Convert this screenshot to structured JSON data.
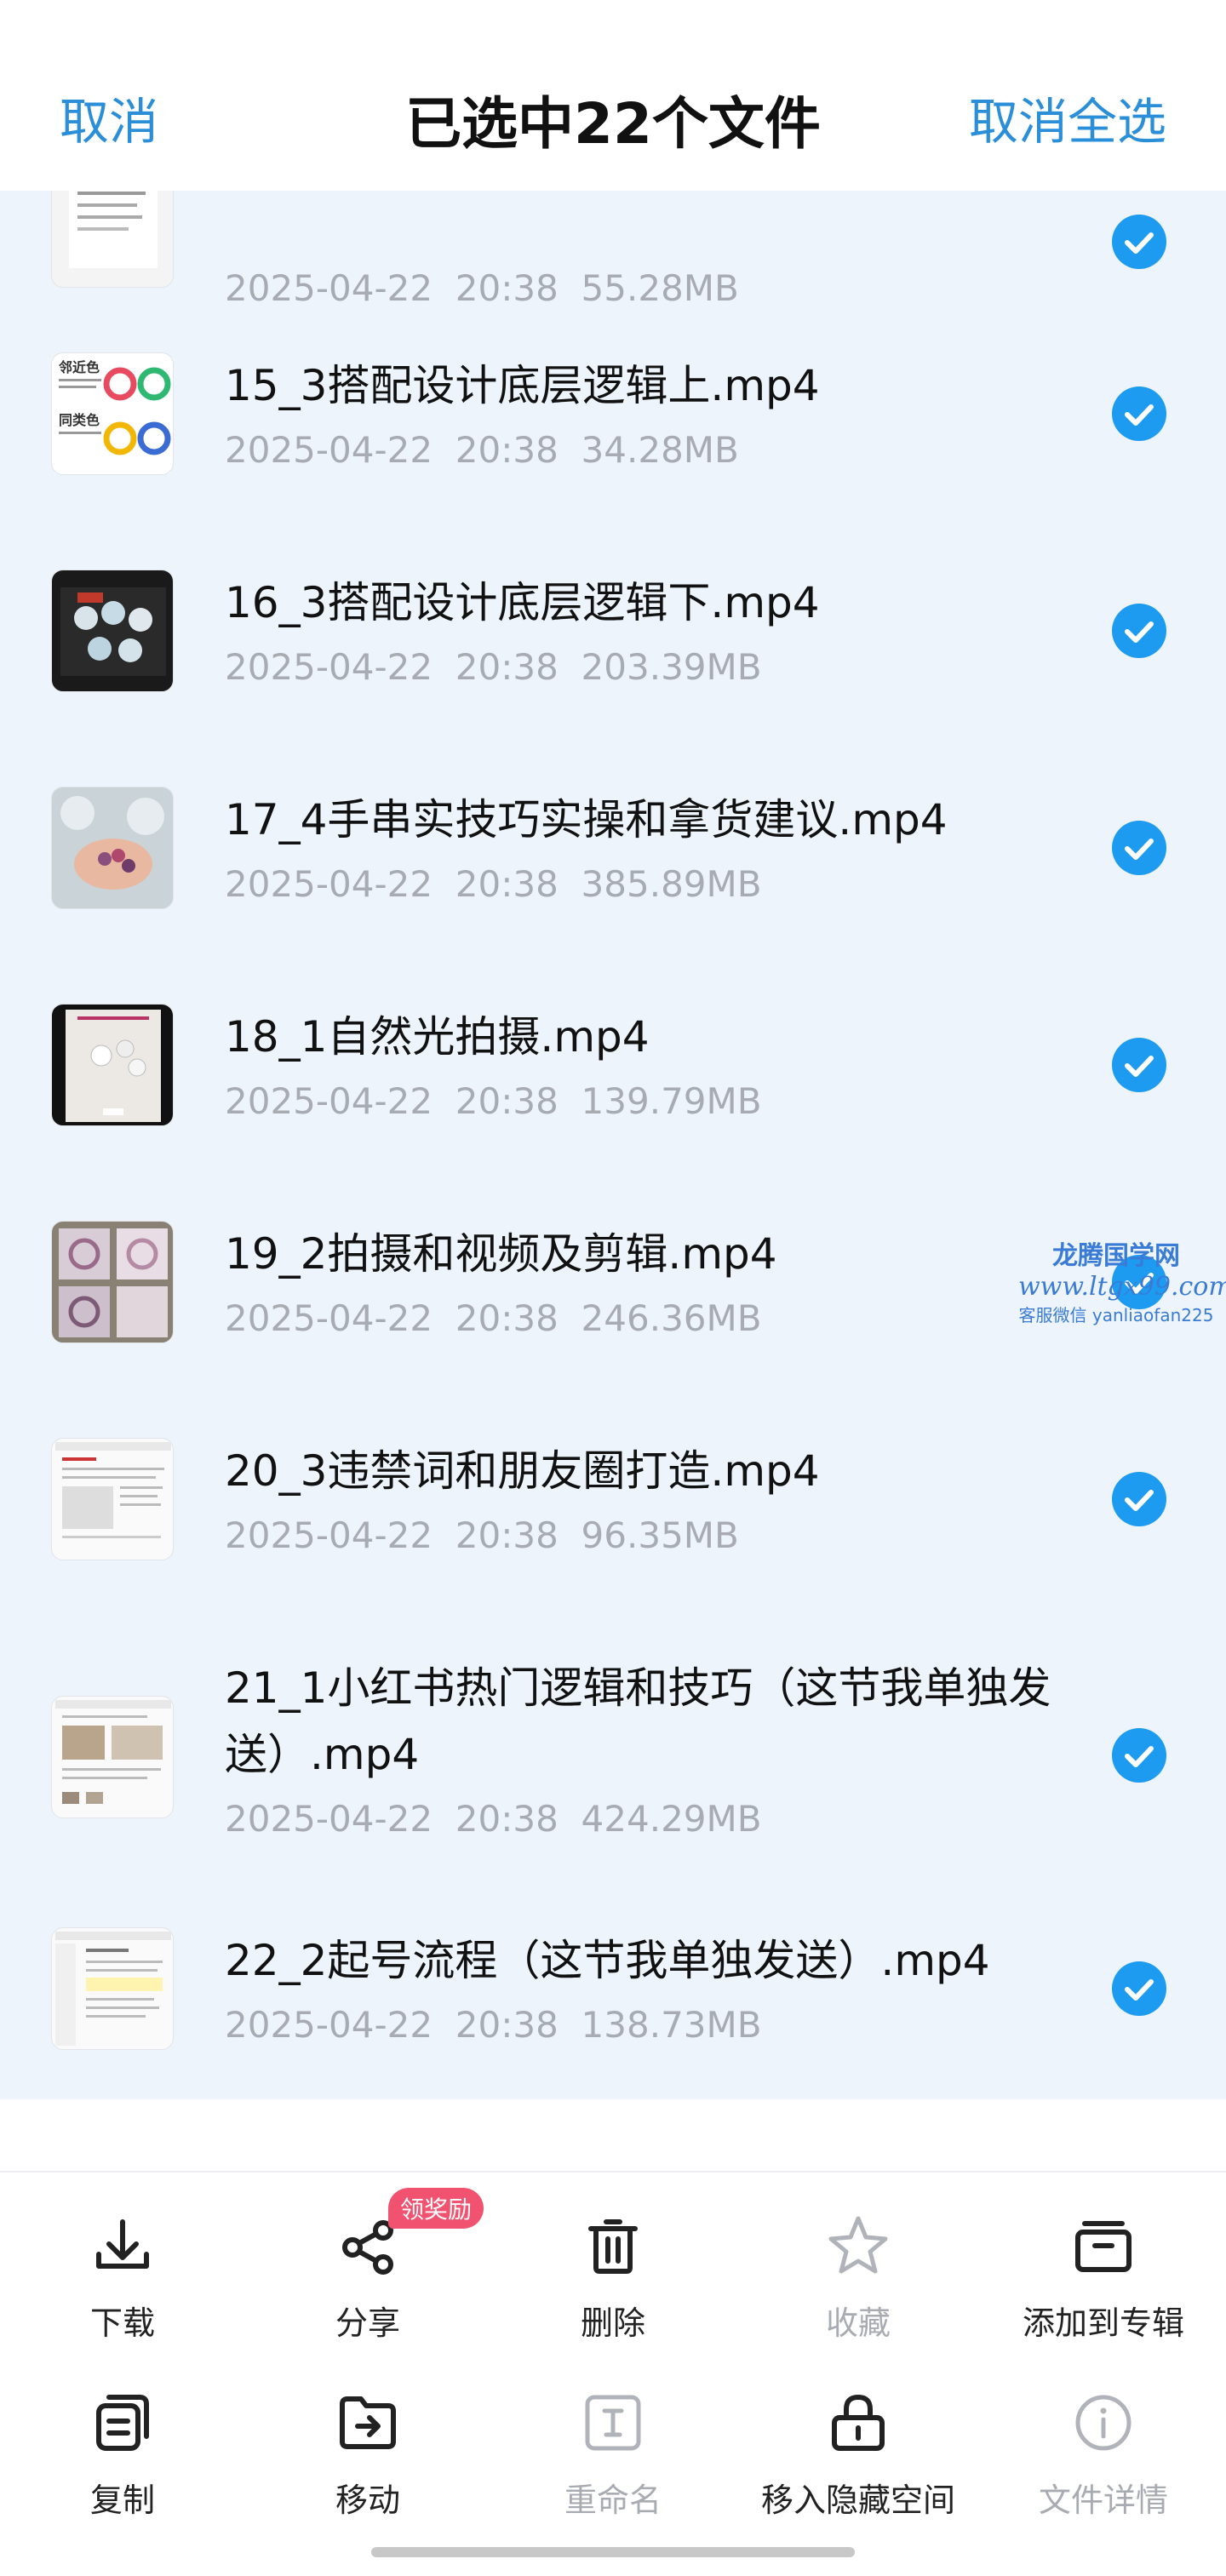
{
  "header": {
    "cancel_label": "取消",
    "title": "已选中22个文件",
    "deselect_all_label": "取消全选"
  },
  "files": [
    {
      "name": "",
      "date": "2025-04-22",
      "time": "20:38",
      "size": "55.28MB",
      "selected": true
    },
    {
      "name": "15_3搭配设计底层逻辑上.mp4",
      "date": "2025-04-22",
      "time": "20:38",
      "size": "34.28MB",
      "selected": true
    },
    {
      "name": "16_3搭配设计底层逻辑下.mp4",
      "date": "2025-04-22",
      "time": "20:38",
      "size": "203.39MB",
      "selected": true
    },
    {
      "name": "17_4手串实技巧实操和拿货建议.mp4",
      "date": "2025-04-22",
      "time": "20:38",
      "size": "385.89MB",
      "selected": true
    },
    {
      "name": "18_1自然光拍摄.mp4",
      "date": "2025-04-22",
      "time": "20:38",
      "size": "139.79MB",
      "selected": true
    },
    {
      "name": "19_2拍摄和视频及剪辑.mp4",
      "date": "2025-04-22",
      "time": "20:38",
      "size": "246.36MB",
      "selected": true
    },
    {
      "name": "20_3违禁词和朋友圈打造.mp4",
      "date": "2025-04-22",
      "time": "20:38",
      "size": "96.35MB",
      "selected": true
    },
    {
      "name": "21_1小红书热门逻辑和技巧（这节我单独发送）.mp4",
      "date": "2025-04-22",
      "time": "20:38",
      "size": "424.29MB",
      "selected": true
    },
    {
      "name": "22_2起号流程（这节我单独发送）.mp4",
      "date": "2025-04-22",
      "time": "20:38",
      "size": "138.73MB",
      "selected": true
    }
  ],
  "watermark": {
    "line1": "龙腾国学网",
    "line2": "www.ltgx99.com",
    "line3": "客服微信 yanliaofan225"
  },
  "toolbar": {
    "download": "下载",
    "share": "分享",
    "share_badge": "领奖励",
    "delete": "删除",
    "favorite": "收藏",
    "add_to_album": "添加到专辑",
    "copy": "复制",
    "move": "移动",
    "rename": "重命名",
    "move_to_hidden": "移入隐藏空间",
    "file_details": "文件详情"
  },
  "colors": {
    "accent": "#2a8fd8",
    "check": "#1d9bf0",
    "list_bg": "#edf4fb",
    "meta_text": "#a8acb2",
    "badge": "#f05270"
  }
}
